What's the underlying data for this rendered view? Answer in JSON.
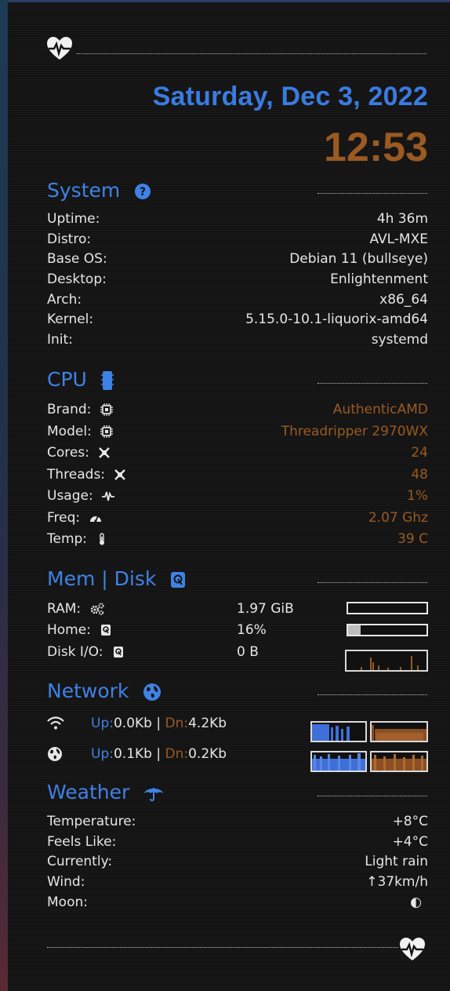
{
  "header": {
    "date": "Saturday, Dec 3, 2022",
    "time": "12:53"
  },
  "system": {
    "title": "System",
    "rows": [
      {
        "label": "Uptime:",
        "value": "4h 36m"
      },
      {
        "label": "Distro:",
        "value": "AVL-MXE"
      },
      {
        "label": "Base OS:",
        "value": "Debian 11 (bullseye)"
      },
      {
        "label": "Desktop:",
        "value": "Enlightenment"
      },
      {
        "label": "Arch:",
        "value": "x86_64"
      },
      {
        "label": "Kernel:",
        "value": "5.15.0-10.1-liquorix-amd64"
      },
      {
        "label": "Init:",
        "value": "systemd"
      }
    ]
  },
  "cpu": {
    "title": "CPU",
    "rows": [
      {
        "label": "Brand:",
        "icon": "chip-icon",
        "value": "AuthenticAMD"
      },
      {
        "label": "Model:",
        "icon": "chip-icon",
        "value": "Threadripper 2970WX"
      },
      {
        "label": "Cores:",
        "icon": "cores-icon",
        "value": "24"
      },
      {
        "label": "Threads:",
        "icon": "threads-icon",
        "value": "48"
      },
      {
        "label": "Usage:",
        "icon": "pulse-icon",
        "value": "1%"
      },
      {
        "label": "Freq:",
        "icon": "gauge-icon",
        "value": "2.07 Ghz"
      },
      {
        "label": "Temp:",
        "icon": "thermometer-icon",
        "value": "39 C"
      }
    ]
  },
  "memdisk": {
    "title_mem": "Mem",
    "separator": "|",
    "title_disk": "Disk",
    "ram_label": "RAM:",
    "ram_value": "1.97 GiB",
    "ram_fraction": 0.0,
    "home_label": "Home:",
    "home_value": "16%",
    "home_fraction": 0.16,
    "diskio_label": "Disk I/O:",
    "diskio_value": "0 B"
  },
  "network": {
    "title": "Network",
    "wifi": {
      "up_label": "Up:",
      "up_value": "0.0Kb",
      "sep": "|",
      "dn_label": "Dn:",
      "dn_value": "4.2Kb"
    },
    "globe": {
      "up_label": "Up:",
      "up_value": "0.1Kb",
      "sep": "|",
      "dn_label": "Dn:",
      "dn_value": "0.2Kb"
    }
  },
  "weather": {
    "title": "Weather",
    "rows": [
      {
        "label": "Temperature:",
        "value": "+8°C"
      },
      {
        "label": "Feels Like:",
        "value": "+4°C"
      },
      {
        "label": "Currently:",
        "value": "Light rain"
      },
      {
        "label": "Wind:",
        "value": "↑37km/h"
      },
      {
        "label": "Moon:",
        "value": "◐"
      }
    ]
  },
  "colors": {
    "accent_blue": "#3f82e6",
    "accent_orange": "#9a5a22",
    "text": "#e6e6e6",
    "background": "#141414"
  }
}
